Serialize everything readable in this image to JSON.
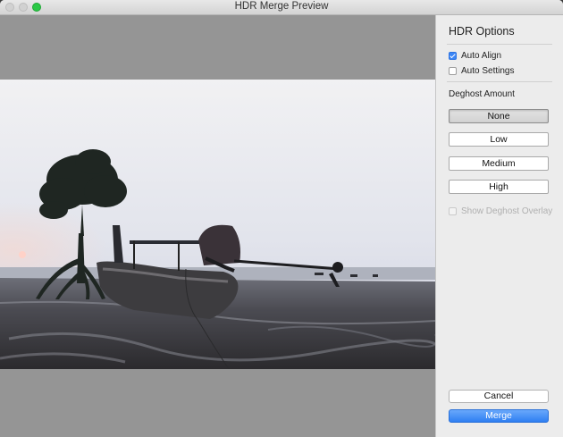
{
  "window": {
    "title": "HDR Merge Preview"
  },
  "options": {
    "heading": "HDR Options",
    "auto_align": {
      "label": "Auto Align",
      "checked": true
    },
    "auto_settings": {
      "label": "Auto Settings",
      "checked": false
    },
    "deghost": {
      "label": "Deghost Amount",
      "buttons": [
        "None",
        "Low",
        "Medium",
        "High"
      ],
      "selected": "None"
    },
    "show_overlay": {
      "label": "Show Deghost Overlay",
      "checked": false,
      "enabled": false
    }
  },
  "actions": {
    "cancel": "Cancel",
    "merge": "Merge"
  },
  "colors": {
    "accent": "#3b86f6",
    "preview_bg": "#959595",
    "panel_bg": "#ececec"
  }
}
